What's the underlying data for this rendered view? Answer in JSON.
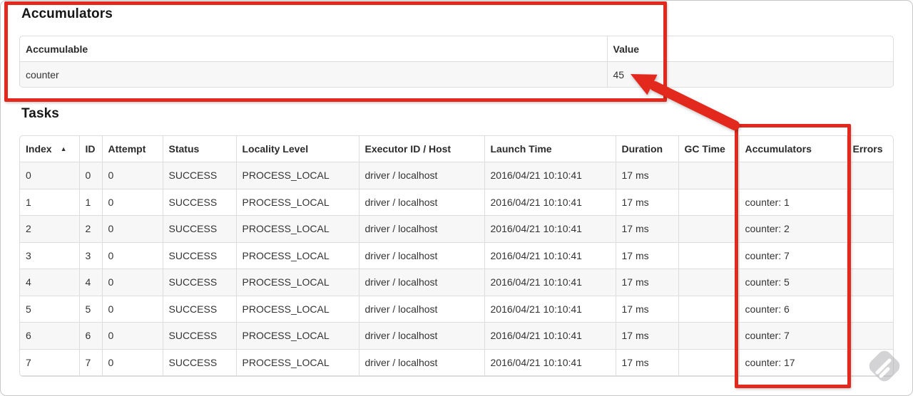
{
  "accumulators": {
    "heading": "Accumulators",
    "columns": [
      "Accumulable",
      "Value"
    ],
    "rows": [
      {
        "name": "counter",
        "value": "45"
      }
    ]
  },
  "tasks": {
    "heading": "Tasks",
    "sort_indicator": "▲",
    "columns": [
      "Index",
      "ID",
      "Attempt",
      "Status",
      "Locality Level",
      "Executor ID / Host",
      "Launch Time",
      "Duration",
      "GC Time",
      "Accumulators",
      "Errors"
    ],
    "rows": [
      {
        "index": "0",
        "id": "0",
        "attempt": "0",
        "status": "SUCCESS",
        "locality": "PROCESS_LOCAL",
        "executor": "driver / localhost",
        "launch": "2016/04/21 10:10:41",
        "duration": "17 ms",
        "gc": "",
        "accumulators": "",
        "errors": ""
      },
      {
        "index": "1",
        "id": "1",
        "attempt": "0",
        "status": "SUCCESS",
        "locality": "PROCESS_LOCAL",
        "executor": "driver / localhost",
        "launch": "2016/04/21 10:10:41",
        "duration": "17 ms",
        "gc": "",
        "accumulators": "counter: 1",
        "errors": ""
      },
      {
        "index": "2",
        "id": "2",
        "attempt": "0",
        "status": "SUCCESS",
        "locality": "PROCESS_LOCAL",
        "executor": "driver / localhost",
        "launch": "2016/04/21 10:10:41",
        "duration": "17 ms",
        "gc": "",
        "accumulators": "counter: 2",
        "errors": ""
      },
      {
        "index": "3",
        "id": "3",
        "attempt": "0",
        "status": "SUCCESS",
        "locality": "PROCESS_LOCAL",
        "executor": "driver / localhost",
        "launch": "2016/04/21 10:10:41",
        "duration": "17 ms",
        "gc": "",
        "accumulators": "counter: 7",
        "errors": ""
      },
      {
        "index": "4",
        "id": "4",
        "attempt": "0",
        "status": "SUCCESS",
        "locality": "PROCESS_LOCAL",
        "executor": "driver / localhost",
        "launch": "2016/04/21 10:10:41",
        "duration": "17 ms",
        "gc": "",
        "accumulators": "counter: 5",
        "errors": ""
      },
      {
        "index": "5",
        "id": "5",
        "attempt": "0",
        "status": "SUCCESS",
        "locality": "PROCESS_LOCAL",
        "executor": "driver / localhost",
        "launch": "2016/04/21 10:10:41",
        "duration": "17 ms",
        "gc": "",
        "accumulators": "counter: 6",
        "errors": ""
      },
      {
        "index": "6",
        "id": "6",
        "attempt": "0",
        "status": "SUCCESS",
        "locality": "PROCESS_LOCAL",
        "executor": "driver / localhost",
        "launch": "2016/04/21 10:10:41",
        "duration": "17 ms",
        "gc": "",
        "accumulators": "counter: 7",
        "errors": ""
      },
      {
        "index": "7",
        "id": "7",
        "attempt": "0",
        "status": "SUCCESS",
        "locality": "PROCESS_LOCAL",
        "executor": "driver / localhost",
        "launch": "2016/04/21 10:10:41",
        "duration": "17 ms",
        "gc": "",
        "accumulators": "counter: 17",
        "errors": ""
      }
    ]
  },
  "annotations": {
    "highlight_color": "#e3291d"
  }
}
